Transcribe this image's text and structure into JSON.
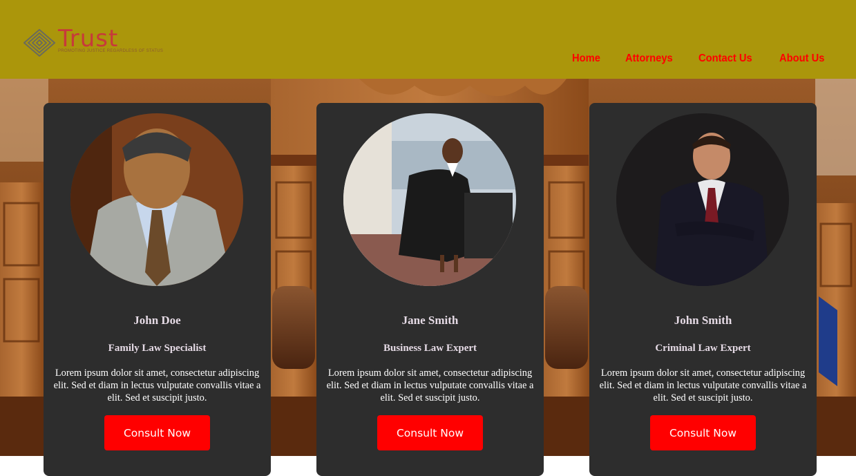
{
  "header": {
    "background": "#ab960b",
    "logo": {
      "word": "Trust",
      "tagline": "PROMOTING JUSTICE REGARDLESS OF STATUS"
    },
    "nav": [
      {
        "label": "Home"
      },
      {
        "label": "Attorneys"
      },
      {
        "label": "Contact Us"
      },
      {
        "label": "About Us"
      }
    ],
    "nav_color": "#ff0000"
  },
  "attorneys": [
    {
      "name": "John Doe",
      "role": "Family Law Specialist",
      "description": "Lorem ipsum dolor sit amet, consectetur adipiscing elit. Sed et diam in lectus vulputate convallis vitae a elit. Sed et suscipit justo.",
      "button": "Consult Now"
    },
    {
      "name": "Jane Smith",
      "role": "Business Law Expert",
      "description": "Lorem ipsum dolor sit amet, consectetur adipiscing elit. Sed et diam in lectus vulputate convallis vitae a elit. Sed et suscipit justo.",
      "button": "Consult Now"
    },
    {
      "name": "John Smith",
      "role": "Criminal Law Expert",
      "description": "Lorem ipsum dolor sit amet, consectetur adipiscing elit. Sed et diam in lectus vulputate convallis vitae a elit. Sed et suscipit justo.",
      "button": "Consult Now"
    }
  ],
  "colors": {
    "card_background": "#2d2d2d",
    "button": "#ff0000"
  }
}
